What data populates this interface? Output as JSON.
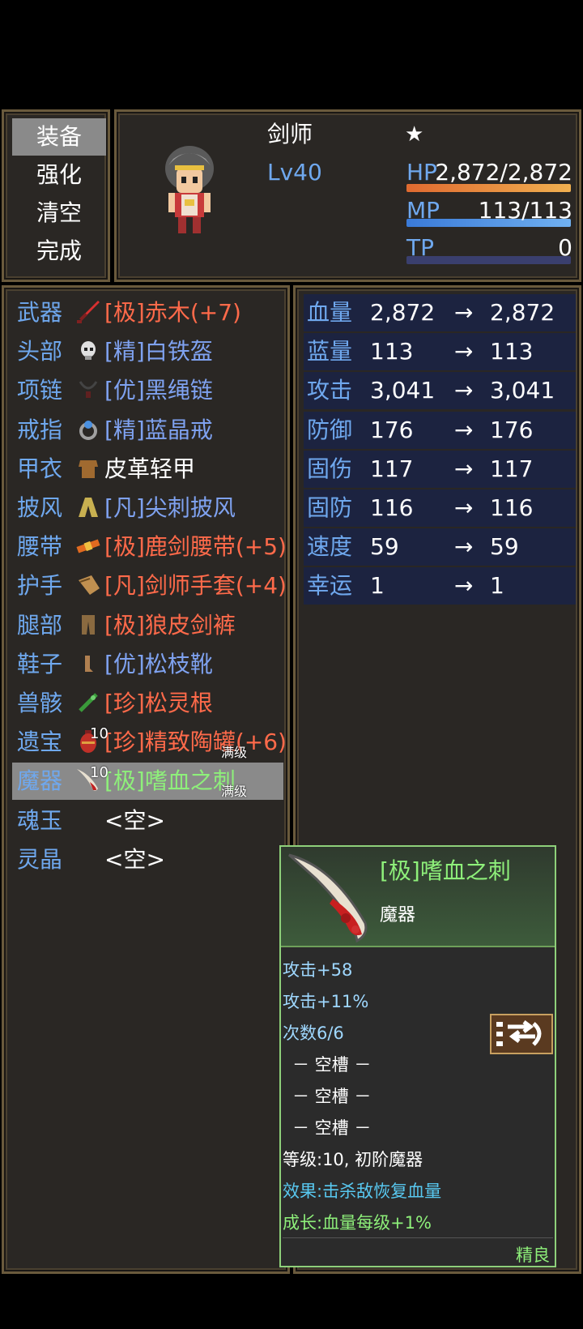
{
  "command_menu": [
    "装备",
    "强化",
    "清空",
    "完成"
  ],
  "actor": {
    "class": "剑师",
    "star": "★",
    "level": "Lv40",
    "hp_label": "HP",
    "hp_value": "2,872/2,872",
    "hp_ratio": 1.0,
    "mp_label": "MP",
    "mp_value": "113/113",
    "mp_ratio": 1.0,
    "tp_label": "TP",
    "tp_value": "0",
    "tp_ratio": 0.0
  },
  "equipment": [
    {
      "slot": "武器",
      "name": "[极]赤木(+7)",
      "color": "#ff6a4a",
      "icon": "red-sword-icon"
    },
    {
      "slot": "头部",
      "name": "[精]白铁盔",
      "color": "#7fa2f0",
      "icon": "skull-helm-icon"
    },
    {
      "slot": "项链",
      "name": "[优]黑绳链",
      "color": "#7fa2f0",
      "icon": "necklace-icon"
    },
    {
      "slot": "戒指",
      "name": "[精]蓝晶戒",
      "color": "#7fa2f0",
      "icon": "ring-icon"
    },
    {
      "slot": "甲衣",
      "name": "皮革轻甲",
      "color": "#ffffff",
      "icon": "leather-armor-icon"
    },
    {
      "slot": "披风",
      "name": "[凡]尖刺披风",
      "color": "#7fa2f0",
      "icon": "cloak-icon"
    },
    {
      "slot": "腰带",
      "name": "[极]鹿剑腰带(+5)",
      "color": "#ff6a4a",
      "icon": "belt-icon"
    },
    {
      "slot": "护手",
      "name": "[凡]剑师手套(+4)",
      "color": "#ff6a4a",
      "icon": "glove-icon"
    },
    {
      "slot": "腿部",
      "name": "[极]狼皮剑裤",
      "color": "#ff6a4a",
      "icon": "pants-icon"
    },
    {
      "slot": "鞋子",
      "name": "[优]松枝靴",
      "color": "#7fa2f0",
      "icon": "boot-icon"
    },
    {
      "slot": "兽骸",
      "name": "[珍]松灵根",
      "color": "#ff6a4a",
      "icon": "root-icon"
    },
    {
      "slot": "遗宝",
      "name": "[珍]精致陶罐(+6)",
      "color": "#ff6a4a",
      "icon": "jar-icon",
      "level": "10",
      "tag": "满级"
    },
    {
      "slot": "魔器",
      "name": "[极]嗜血之刺",
      "color": "#8ef07a",
      "icon": "bloodthorn-icon",
      "level": "10",
      "tag": "满级",
      "selected": true
    },
    {
      "slot": "魂玉",
      "name": "<空>",
      "color": "#ffffff",
      "icon": ""
    },
    {
      "slot": "灵晶",
      "name": "<空>",
      "color": "#ffffff",
      "icon": ""
    }
  ],
  "params": [
    {
      "name": "血量",
      "cur": "2,872",
      "arrow": "→",
      "new": "2,872"
    },
    {
      "name": "蓝量",
      "cur": "113",
      "arrow": "→",
      "new": "113"
    },
    {
      "name": "攻击",
      "cur": "3,041",
      "arrow": "→",
      "new": "3,041"
    },
    {
      "name": "防御",
      "cur": "176",
      "arrow": "→",
      "new": "176"
    },
    {
      "name": "固伤",
      "cur": "117",
      "arrow": "→",
      "new": "117"
    },
    {
      "name": "固防",
      "cur": "116",
      "arrow": "→",
      "new": "116"
    },
    {
      "name": "速度",
      "cur": "59",
      "arrow": "→",
      "new": "59"
    },
    {
      "name": "幸运",
      "cur": "1",
      "arrow": "→",
      "new": "1"
    }
  ],
  "tooltip": {
    "title": "[极]嗜血之刺",
    "type": "魔器",
    "lines": [
      {
        "text": "攻击+58",
        "color": "#9fd8ff"
      },
      {
        "text": "攻击+11%",
        "color": "#9fd8ff"
      },
      {
        "text": "次数6/6",
        "color": "#9fd8ff"
      },
      {
        "text": "－ 空槽 －",
        "color": "#ffffff"
      },
      {
        "text": "－ 空槽 －",
        "color": "#ffffff"
      },
      {
        "text": "－ 空槽 －",
        "color": "#ffffff"
      },
      {
        "text": "等级:10, 初阶魔器",
        "color": "#ffffff"
      },
      {
        "text": "效果:击杀敌恢复血量",
        "color": "#58c8f0"
      },
      {
        "text": "成长:血量每级+1%",
        "color": "#8ef07a"
      }
    ],
    "rarity": "精良"
  },
  "colors": {
    "hp": "#e88b3a",
    "mp": "#4a8ee0",
    "tp": "#3a3f6e",
    "slot": "#6fa8ee"
  }
}
